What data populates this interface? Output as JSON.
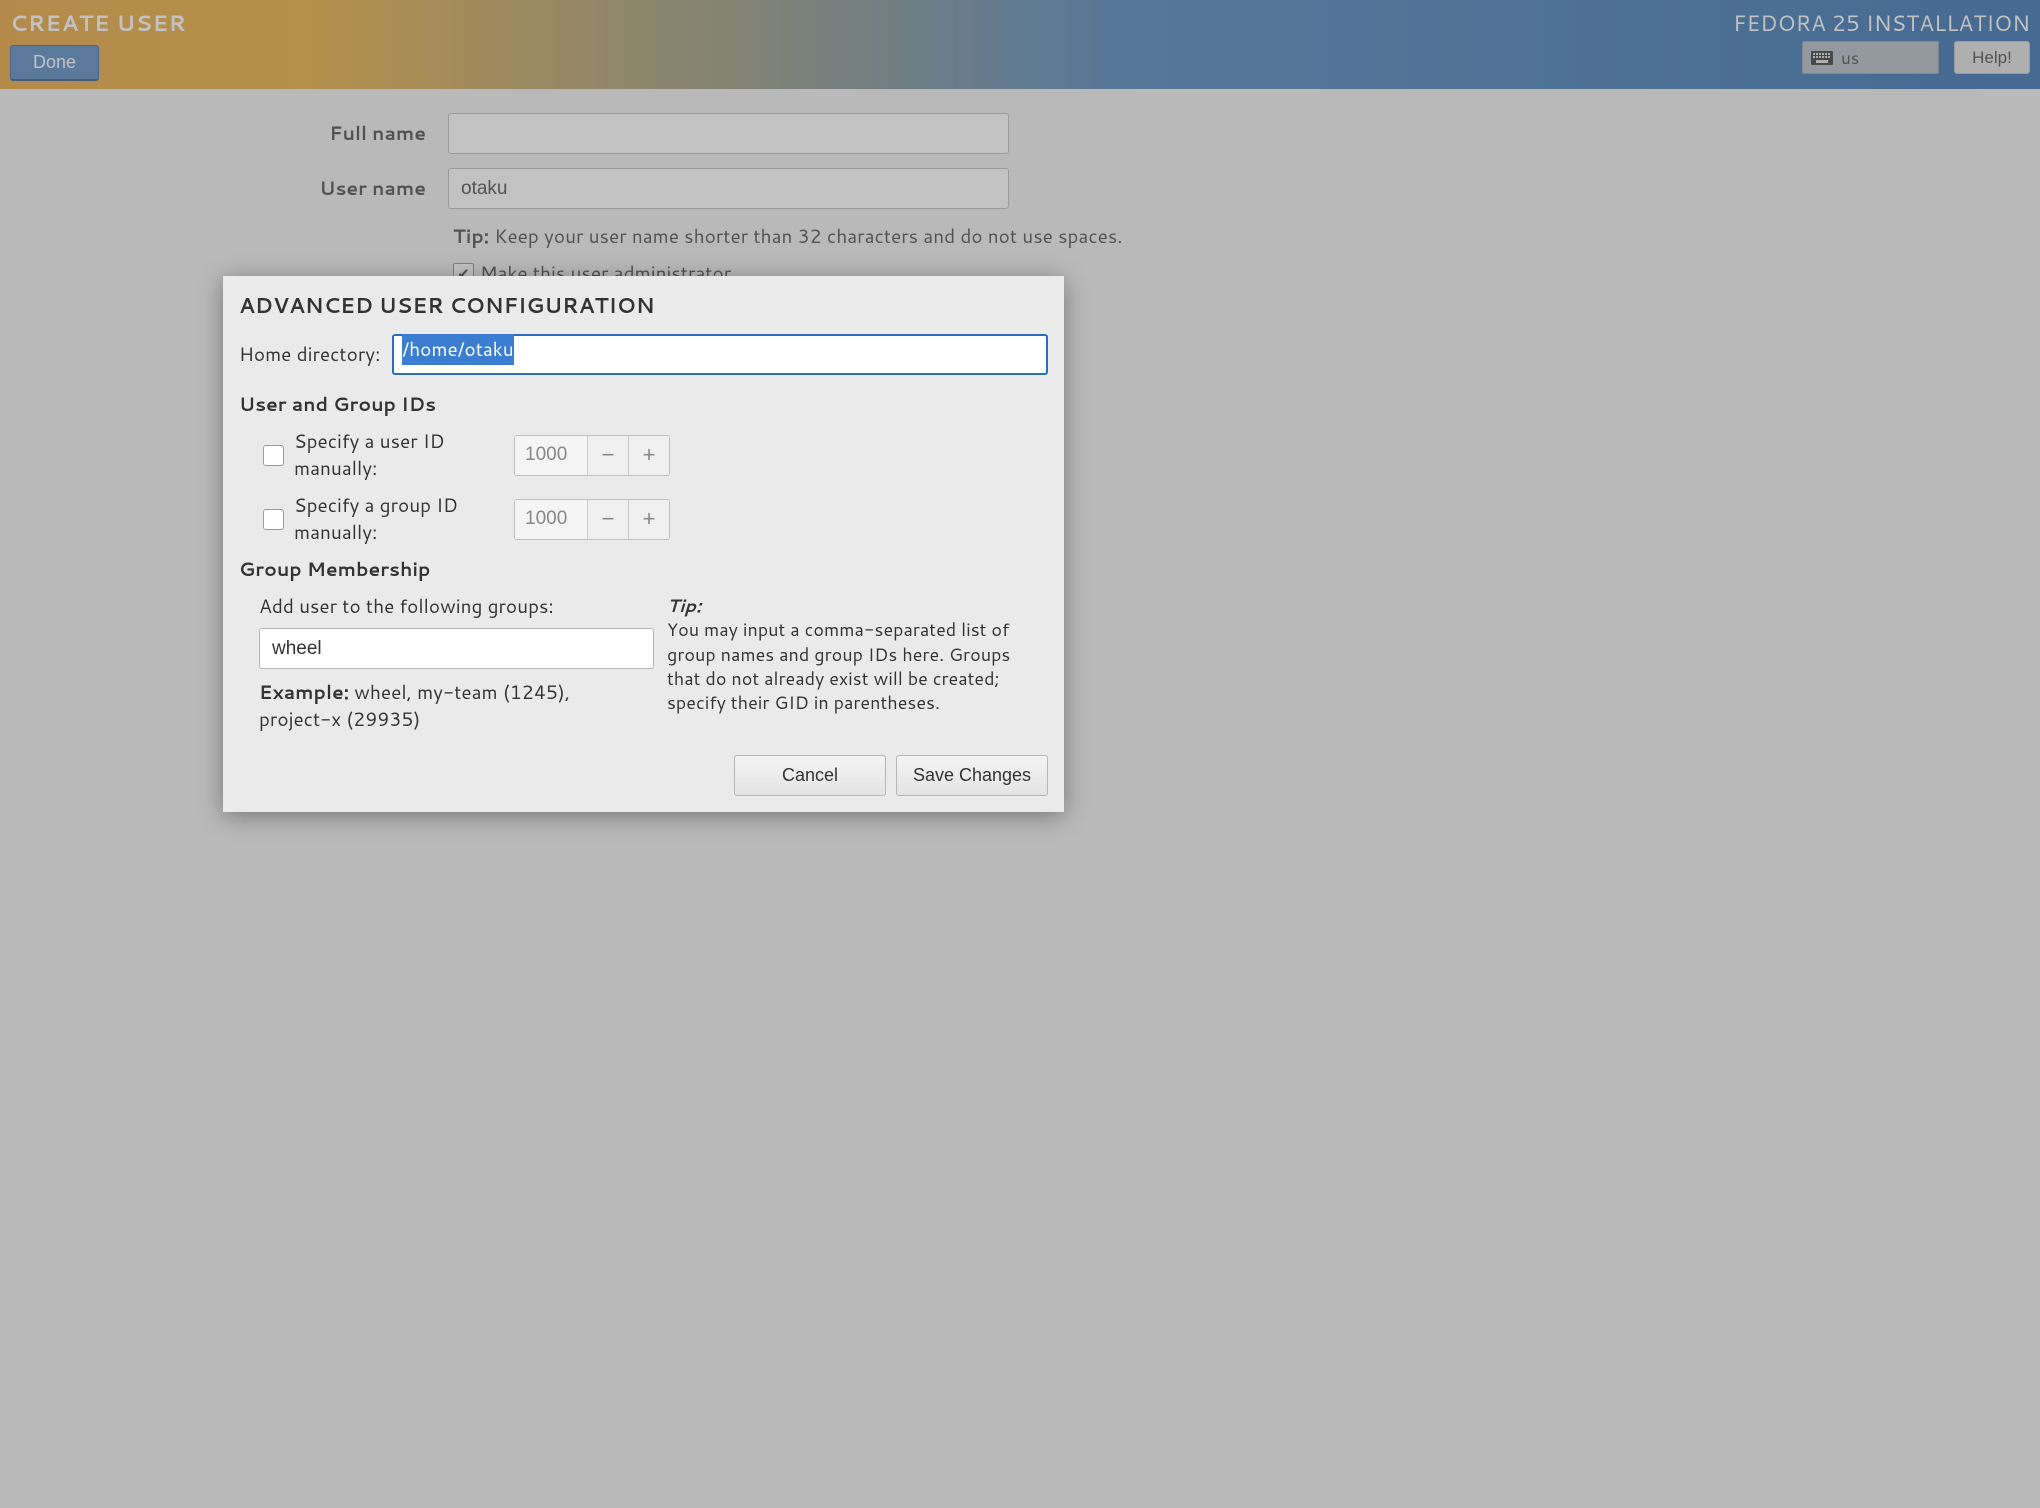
{
  "header": {
    "title": "CREATE USER",
    "product": "FEDORA 25 INSTALLATION",
    "done": "Done",
    "keyboard_layout": "us",
    "help": "Help!"
  },
  "form": {
    "fullname_label": "Full name",
    "fullname_value": "",
    "username_label": "User name",
    "username_value": "otaku",
    "tip_label": "Tip:",
    "tip_text": "Keep your user name shorter than 32 characters and do not use spaces.",
    "admin_label": "Make this user administrator"
  },
  "dialog": {
    "title": "ADVANCED USER CONFIGURATION",
    "home_label": "Home directory:",
    "home_value": "/home/otaku",
    "ids_heading": "User and Group IDs",
    "uid_label": "Specify a user ID manually:",
    "uid_value": "1000",
    "gid_label": "Specify a group ID manually:",
    "gid_value": "1000",
    "membership_heading": "Group Membership",
    "add_groups_label": "Add user to the following groups:",
    "groups_value": "wheel",
    "example_label": "Example:",
    "example_text": "wheel, my-team (1245), project-x (29935)",
    "tip_label": "Tip:",
    "tip_text": "You may input a comma-separated list of group names and group IDs here. Groups that do not already exist will be created; specify their GID in parentheses.",
    "cancel": "Cancel",
    "save": "Save Changes"
  }
}
